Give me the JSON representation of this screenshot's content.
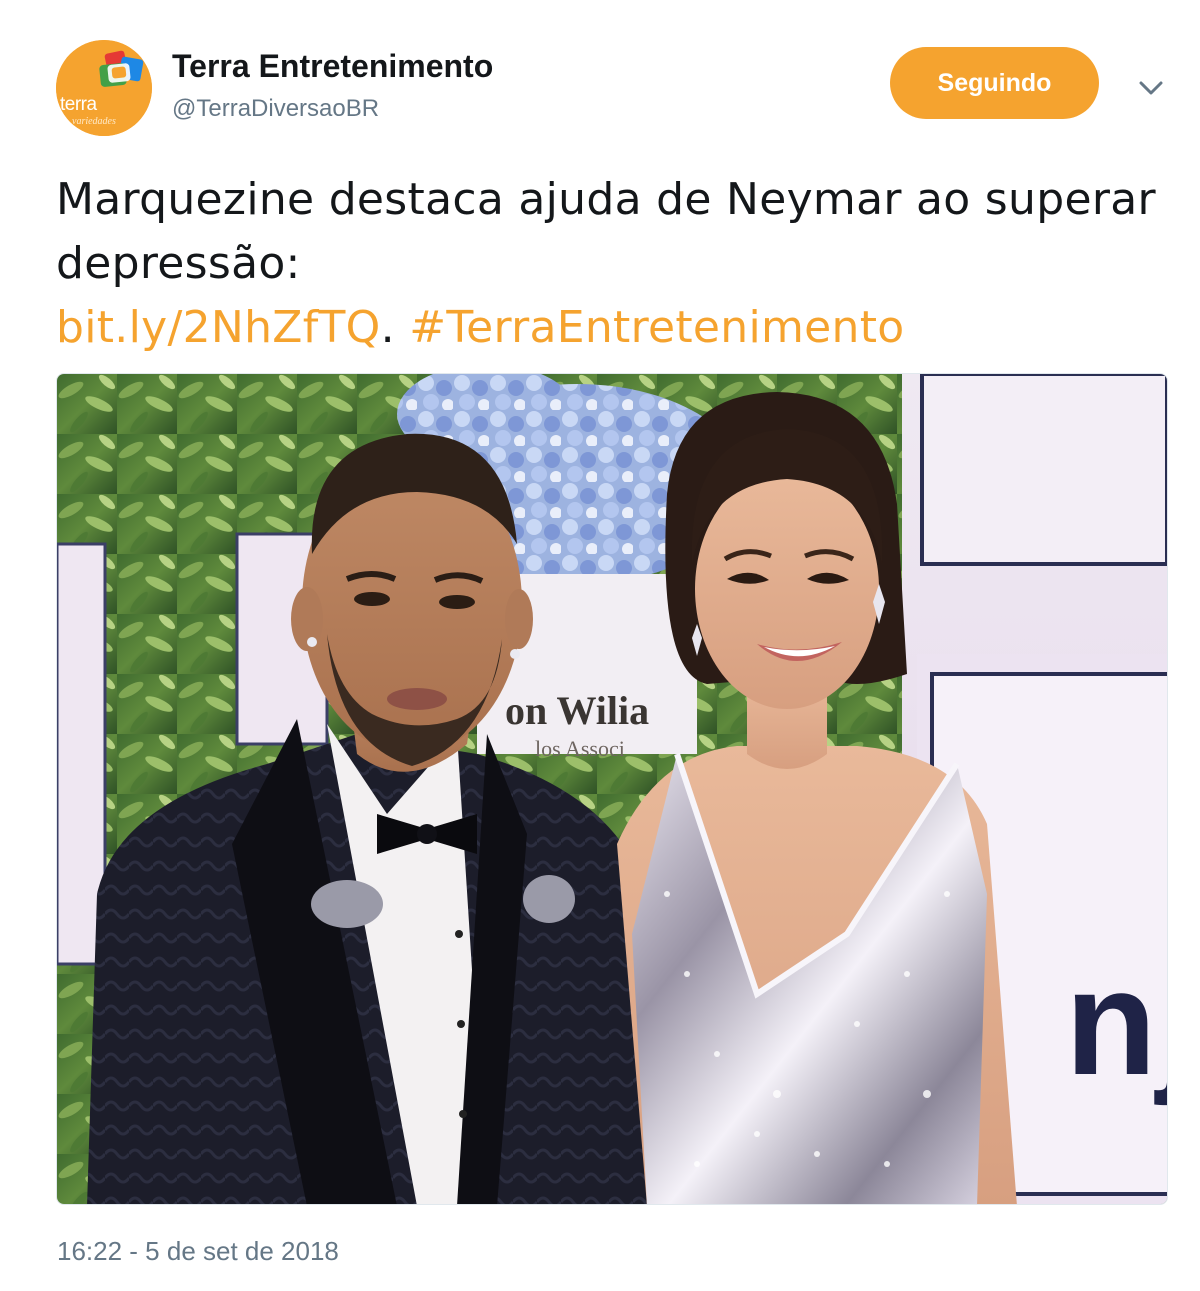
{
  "account": {
    "display_name": "Terra Entretenimento",
    "handle": "@TerraDiversaoBR",
    "avatar_text": "terra",
    "avatar_subtext": "variedades",
    "follow_label": "Seguindo"
  },
  "tweet": {
    "text_main": "Marquezine destaca ajuda de Neymar ao superar depressão:",
    "link": "bit.ly/2NhZfTQ",
    "separator": ".",
    "hashtag": "#TerraEntretenimento",
    "timestamp": "16:22 - 5 de set de 2018"
  },
  "photo": {
    "backdrop_text_1": "on Wilia",
    "backdrop_text_2": "los Associ",
    "banner_text": "nj"
  },
  "icons": {
    "caret": "chevron-down-icon",
    "avatar_logo": "terra-logo"
  },
  "colors": {
    "accent": "#f5a32f",
    "text": "#14171a",
    "secondary": "#657786"
  }
}
